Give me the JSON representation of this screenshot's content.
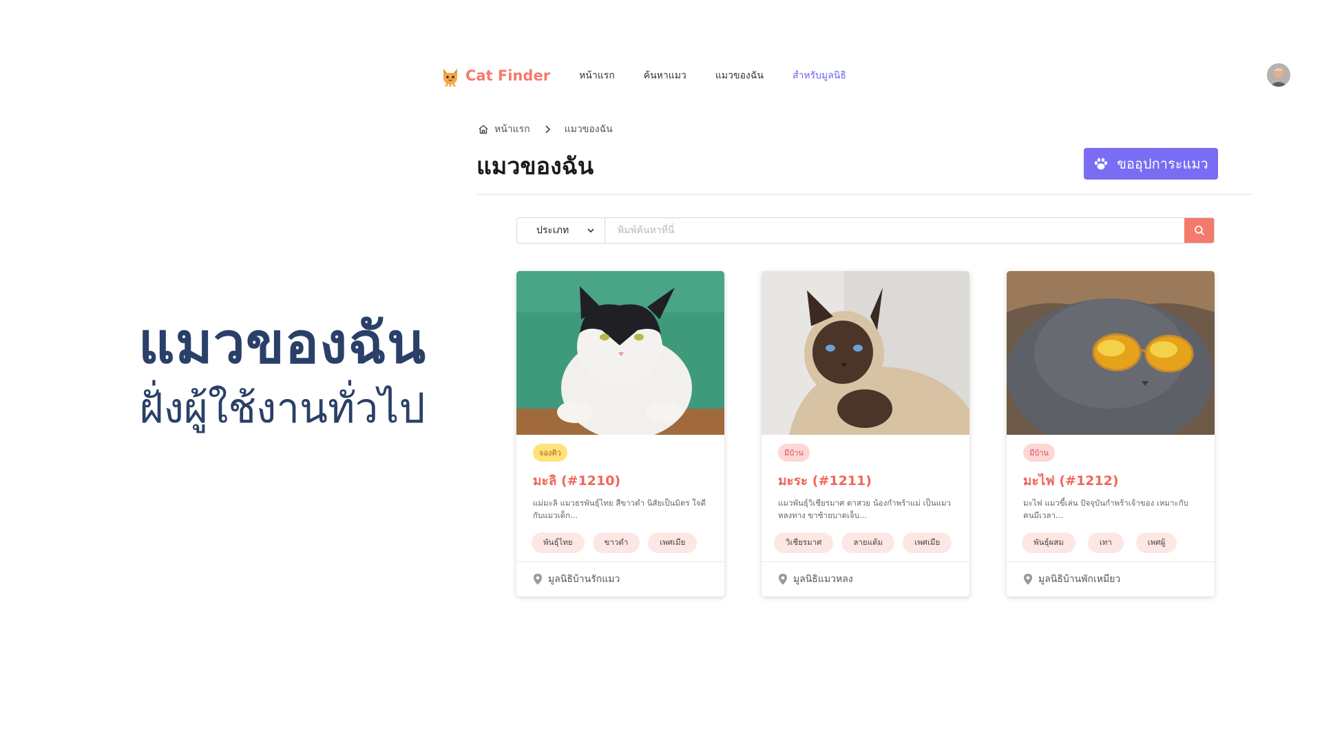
{
  "caption": {
    "title": "แมวของฉัน",
    "subtitle": "ฝั่งผู้ใช้งานทั่วไป"
  },
  "nav": {
    "brand": "Cat Finder",
    "links": [
      "หน้าแรก",
      "ค้นหาแมว",
      "แมวของฉัน",
      "สำหรับมูลนิธิ"
    ],
    "active_index": 3
  },
  "breadcrumb": {
    "home": "หน้าแรก",
    "current": "แมวของฉัน"
  },
  "page": {
    "title": "แมวของฉัน",
    "request_button": "ขออุปการะแมว"
  },
  "search": {
    "type_label": "ประเภท",
    "placeholder": "พิมพ์ค้นหาที่นี่"
  },
  "cards": [
    {
      "status": "จองคิว",
      "status_kind": "queue",
      "name": "มะลิ (#1210)",
      "desc": "แม่มะลิ แมวธรพันธุ์ไทย สีขาวดำ นิสัยเป็นมิตร ใจดีกับแมวเด็ก...",
      "tags": [
        "พันธุ์ไทย",
        "ขาวดำ",
        "เพศเมีย"
      ],
      "foundation": "มูลนิธิบ้านรักแมว",
      "photo": "black-white-cat-on-green"
    },
    {
      "status": "มีบ้าน",
      "status_kind": "home",
      "name": "มะระ (#1211)",
      "desc": "แมวพันธุ์วิเชียรมาศ ตาสวย น้องกำพร้าแม่ เป็นแมวหลงทาง ขาซ้ายบาดเจ็บ...",
      "tags": [
        "วิเชียรมาศ",
        "ลายแต้ม",
        "เพศเมีย"
      ],
      "foundation": "มูลนิธิแมวหลง",
      "photo": "siamese-cat"
    },
    {
      "status": "มีบ้าน",
      "status_kind": "home",
      "name": "มะไฟ (#1212)",
      "desc": "มะไฟ แมวขี้เล่น ปัจจุบันกำพร้าเจ้าของ เหมาะกับคนมีเวลา...",
      "tags": [
        "พันธุ์ผสม",
        "เทา",
        "เพศผู้"
      ],
      "foundation": "มูลนิธิบ้านพักเหมียว",
      "photo": "grey-cat-sunglasses"
    }
  ],
  "colors": {
    "brand": "#f47a6b",
    "accent": "#7a6cf3",
    "caption": "#2a4068",
    "card_name": "#f0665a"
  },
  "icons": [
    "cat-logo-icon",
    "home-icon",
    "chevron-right-icon",
    "paw-icon",
    "chevron-down-icon",
    "search-icon",
    "location-pin-icon"
  ]
}
